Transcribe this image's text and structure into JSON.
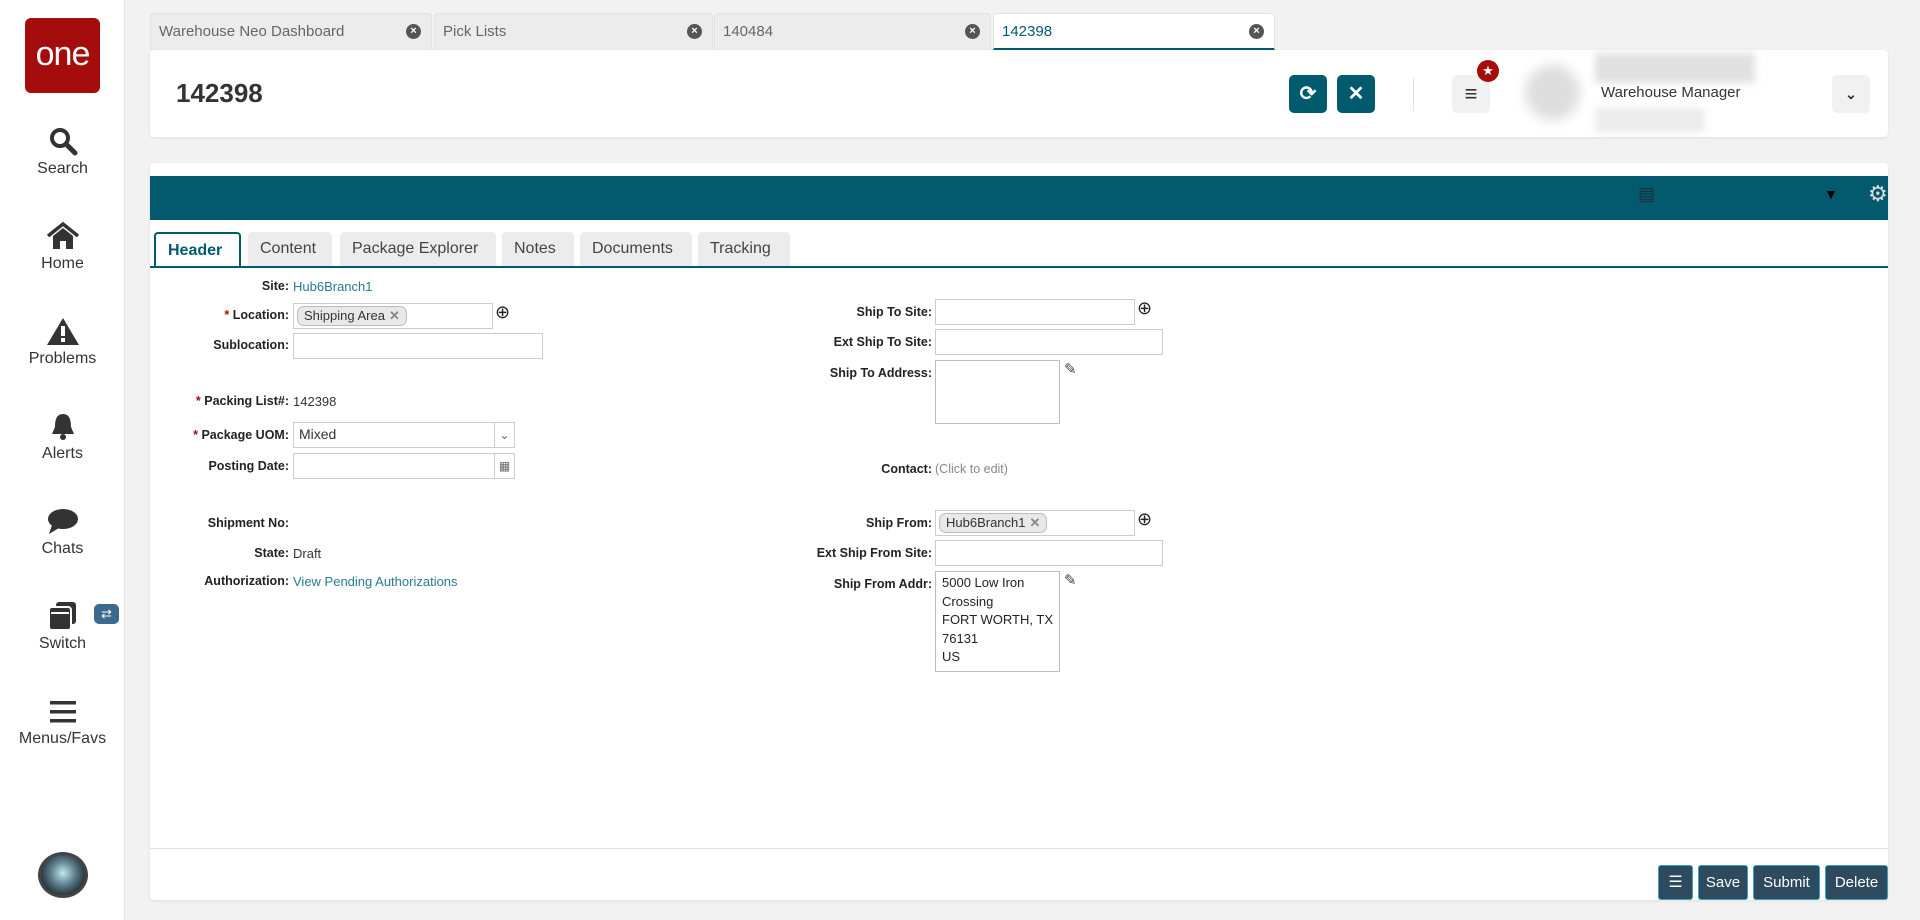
{
  "sidebar": {
    "logo": "one",
    "items": [
      {
        "label": "Search",
        "icon": "search-icon"
      },
      {
        "label": "Home",
        "icon": "home-icon"
      },
      {
        "label": "Problems",
        "icon": "warning-icon"
      },
      {
        "label": "Alerts",
        "icon": "bell-icon"
      },
      {
        "label": "Chats",
        "icon": "chat-icon"
      },
      {
        "label": "Switch",
        "icon": "switch-icon"
      },
      {
        "label": "Menus/Favs",
        "icon": "menu-icon"
      }
    ],
    "switch_badge": "⇄"
  },
  "tabs": [
    {
      "label": "Warehouse Neo Dashboard"
    },
    {
      "label": "Pick Lists"
    },
    {
      "label": "140484"
    },
    {
      "label": "142398",
      "active": true
    }
  ],
  "header": {
    "title": "142398",
    "role": "Warehouse Manager"
  },
  "form_tabs": [
    "Header",
    "Content",
    "Package Explorer",
    "Notes",
    "Documents",
    "Tracking"
  ],
  "form": {
    "site_label": "Site:",
    "site": "Hub6Branch1",
    "location_label": "Location:",
    "location": "Shipping Area",
    "sublocation_label": "Sublocation:",
    "sublocation": "",
    "packing_label": "Packing List#:",
    "packing": "142398",
    "uom_label": "Package UOM:",
    "uom": "Mixed",
    "posting_label": "Posting Date:",
    "posting": "",
    "shipment_label": "Shipment No:",
    "shipment": "",
    "state_label": "State:",
    "state": "Draft",
    "auth_label": "Authorization:",
    "auth": "View Pending Authorizations",
    "ship_to_site_label": "Ship To Site:",
    "ship_to_site": "",
    "ext_ship_to_label": "Ext Ship To Site:",
    "ext_ship_to": "",
    "ship_to_addr_label": "Ship To Address:",
    "ship_to_addr": "",
    "contact_label": "Contact:",
    "contact": "(Click to edit)",
    "ship_from_label": "Ship From:",
    "ship_from": "Hub6Branch1",
    "ext_ship_from_label": "Ext Ship From Site:",
    "ext_ship_from": "",
    "ship_from_addr_label": "Ship From Addr:",
    "ship_from_addr": [
      "5000 Low Iron",
      "Crossing",
      "FORT WORTH, TX",
      "76131",
      "US"
    ]
  },
  "footer": {
    "save": "Save",
    "submit": "Submit",
    "delete": "Delete"
  },
  "colors": {
    "brand": "#a50d0d",
    "teal": "#005a6e",
    "button": "#2d4a5e"
  }
}
